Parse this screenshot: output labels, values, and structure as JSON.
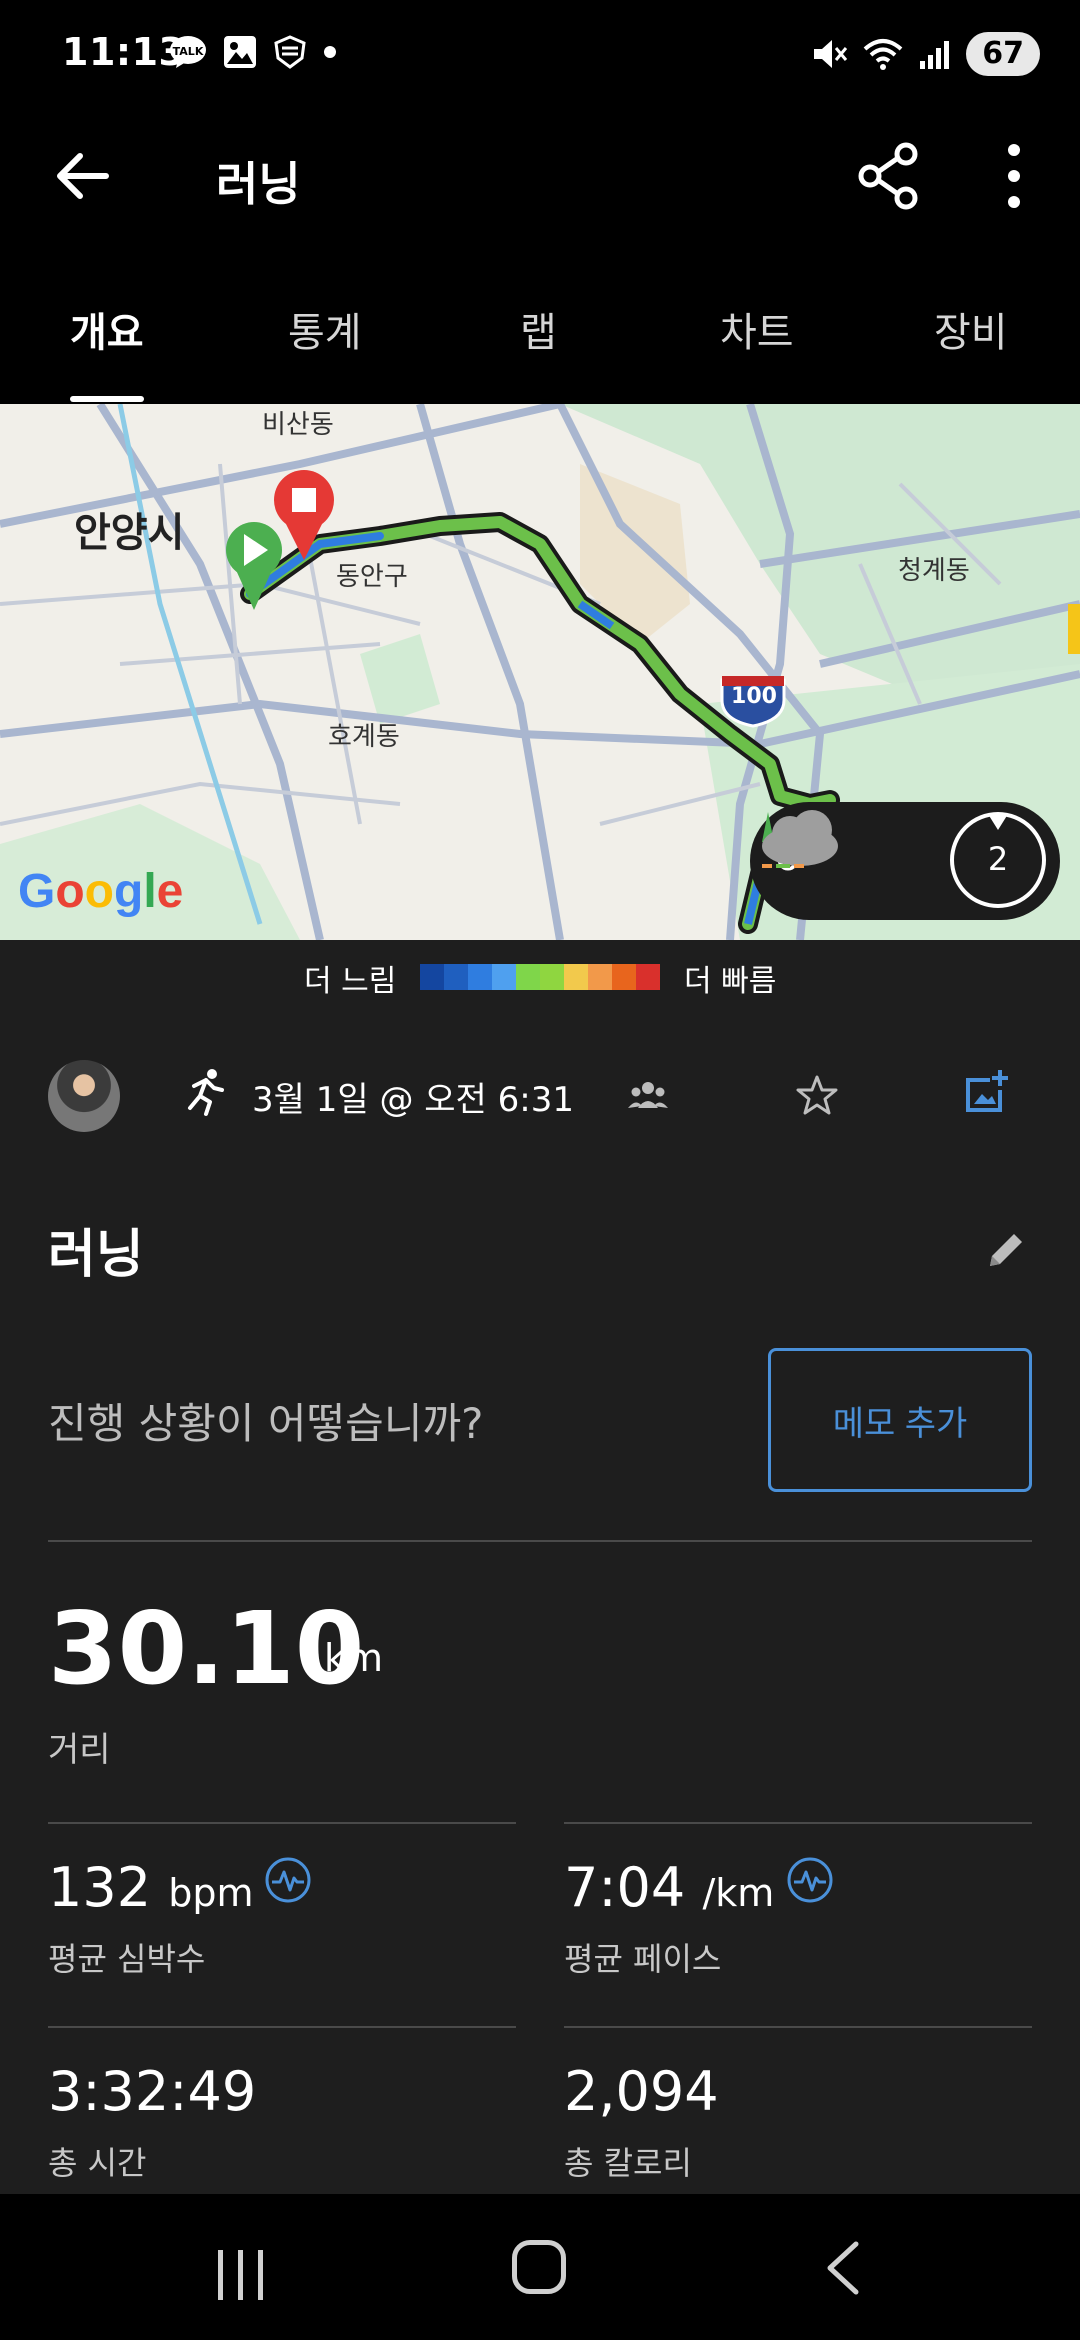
{
  "status_bar": {
    "time": "11:13",
    "battery": "67",
    "left_icons": [
      "talk-icon",
      "image-icon",
      "shield-icon",
      "dot-icon"
    ],
    "right_icons": [
      "mute-icon",
      "wifi-icon",
      "signal-icon",
      "battery-icon"
    ]
  },
  "app_bar": {
    "title": "러닝"
  },
  "tabs": [
    {
      "label": "개요",
      "active": true
    },
    {
      "label": "통계",
      "active": false
    },
    {
      "label": "랩",
      "active": false
    },
    {
      "label": "차트",
      "active": false
    },
    {
      "label": "장비",
      "active": false
    }
  ],
  "map": {
    "city_label": "안양시",
    "labels": {
      "bisan": "비산동",
      "dongan": "동안구",
      "cheonggye": "청계동",
      "hogye": "호계동"
    },
    "highway_shield": "100",
    "google_logo": "Google",
    "weather": {
      "temperature": "0°",
      "wind_badge": "2"
    }
  },
  "legend": {
    "slow_label": "더 느림",
    "fast_label": "더 빠름",
    "colors": [
      "#1446a0",
      "#1f5fbf",
      "#2f7de0",
      "#4fa0ef",
      "#7fd64a",
      "#8fd640",
      "#f2c94c",
      "#f2994a",
      "#e8651d",
      "#d9302c"
    ]
  },
  "activity": {
    "date": "3월 1일 @ 오전 6:31",
    "title": "러닝",
    "prompt": "진행 상황이 어떻습니까?",
    "memo_button": "메모 추가"
  },
  "stats": {
    "distance": {
      "value": "30.10",
      "unit": "km",
      "label": "거리"
    },
    "avg_hr": {
      "value": "132",
      "unit": "bpm",
      "label": "평균 심박수"
    },
    "avg_pace": {
      "value": "7:04",
      "unit": "/km",
      "label": "평균 페이스"
    },
    "total_time": {
      "value": "3:32:49",
      "label": "총 시간"
    },
    "total_calories": {
      "value": "2,094",
      "label": "총 칼로리"
    }
  },
  "colors": {
    "accent_blue": "#4a90d9",
    "background": "#1e1e1e",
    "route_green": "#6cc04a"
  }
}
